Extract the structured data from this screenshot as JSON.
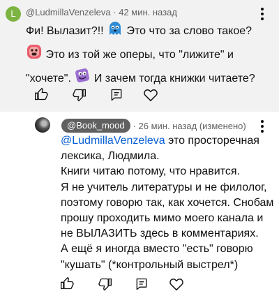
{
  "comment1": {
    "avatar_letter": "L",
    "author": "@LudmillaVenzeleva",
    "separator": "·",
    "time": "42 мин. назад",
    "line1_before": "Фи! Вылазит?!!",
    "line1_after": "Это что за слово такое?",
    "line2": "Это из той же оперы, что \"лижите\" и",
    "line3_before": "\"хочете\".",
    "line3_after": "И зачем тогда книжки читаете?"
  },
  "comment2": {
    "author_chip": "@Book_mood",
    "meta": "· 26 мин. назад (изменено)",
    "mention": "@LudmillaVenzeleva",
    "line1_after": " это просторечная",
    "lines": [
      "лексика, Людмила.",
      "Книги читаю потому, что нравится.",
      "Я не учитель литературы и не филолог,",
      "поэтому говорю так, как хочется. Снобам",
      "прошу проходить мимо моего канала и",
      "не ВЫЛАЗИТЬ здесь в комментариях.",
      "А ещё я иногда вместо \"есть\" говорю",
      "\"кушать\" (*контрольный выстрел*)"
    ]
  },
  "icons": [
    "like-icon",
    "dislike-icon",
    "reply-icon",
    "heart-icon",
    "more-vert-icon"
  ],
  "colors": {
    "background_highlighted": "#f2f2f2",
    "text": "#0f0f0f",
    "meta": "#606060",
    "mention": "#065fd4",
    "avatar_L": "#7cb342"
  }
}
